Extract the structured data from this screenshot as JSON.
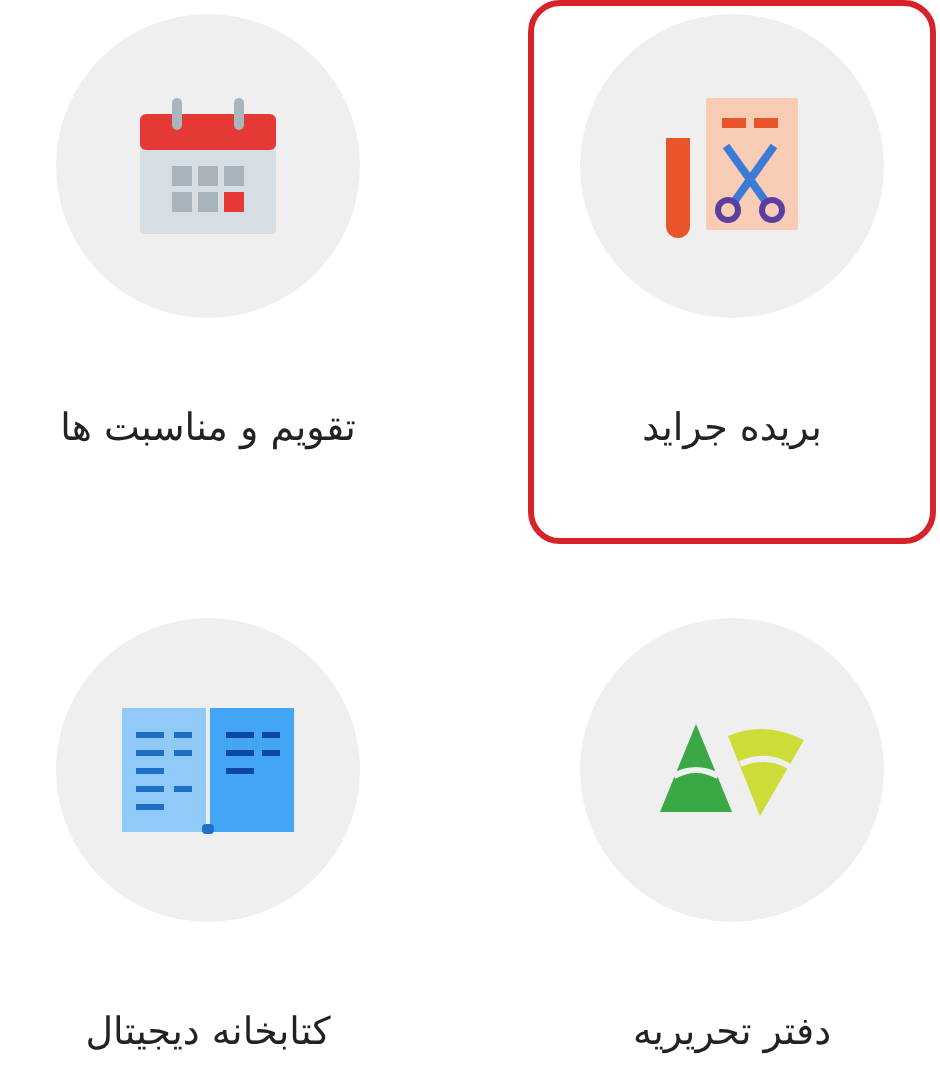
{
  "items": [
    {
      "kind": "clipping",
      "label": "بریده جراید",
      "selected": true
    },
    {
      "kind": "calendar",
      "label": "تقویم و مناسبت ها",
      "selected": false
    },
    {
      "kind": "notes",
      "label": "دفتر تحریریه",
      "selected": false
    },
    {
      "kind": "library",
      "label": "کتابخانه دیجیتال",
      "selected": false
    }
  ]
}
